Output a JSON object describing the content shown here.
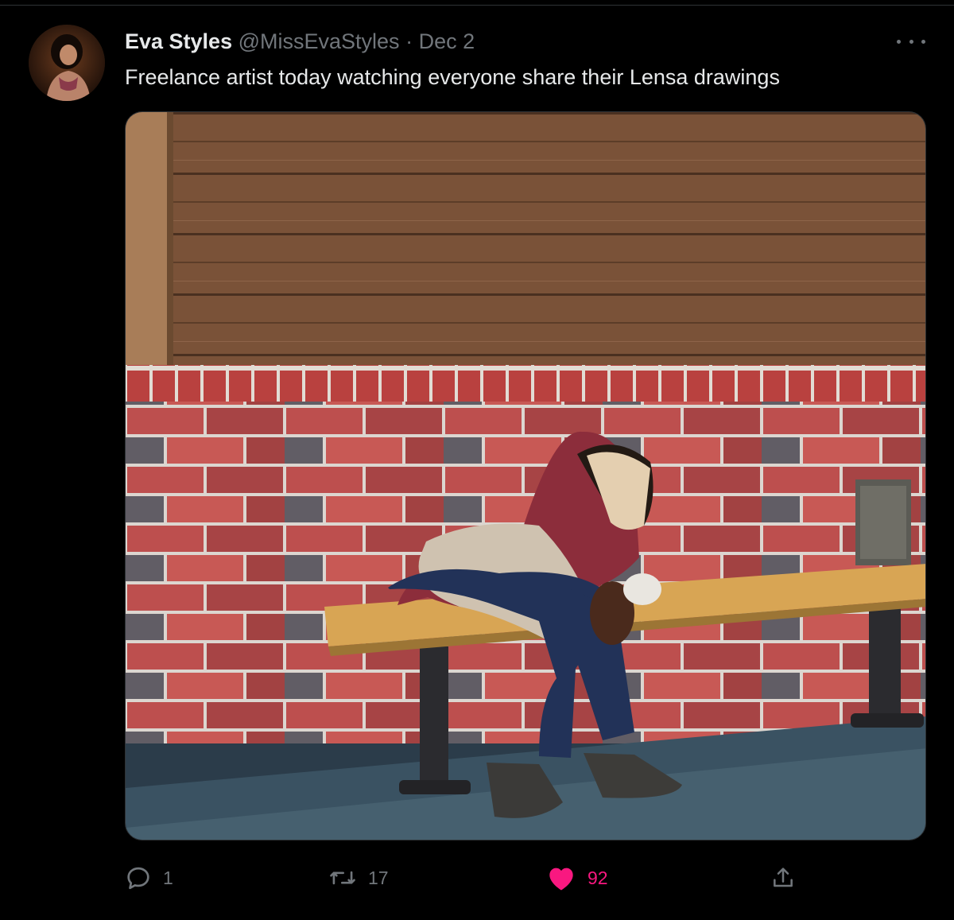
{
  "tweet": {
    "author_name": "Eva Styles",
    "handle": "@MissEvaStyles",
    "separator": "·",
    "date": "Dec 2",
    "text": "Freelance artist today watching everyone share their Lensa drawings"
  },
  "icons": {
    "avatar": "avatar",
    "more": "more-horizontal-icon",
    "reply": "reply-icon",
    "retweet": "retweet-icon",
    "like": "heart-icon",
    "share": "share-icon"
  },
  "actions": {
    "replies": "1",
    "retweets": "17",
    "likes": "92"
  },
  "media": {
    "description_hidden": ""
  },
  "colors": {
    "background": "#000000",
    "text_primary": "#e7e9ea",
    "text_secondary": "#71767b",
    "like_active": "#f91880"
  }
}
